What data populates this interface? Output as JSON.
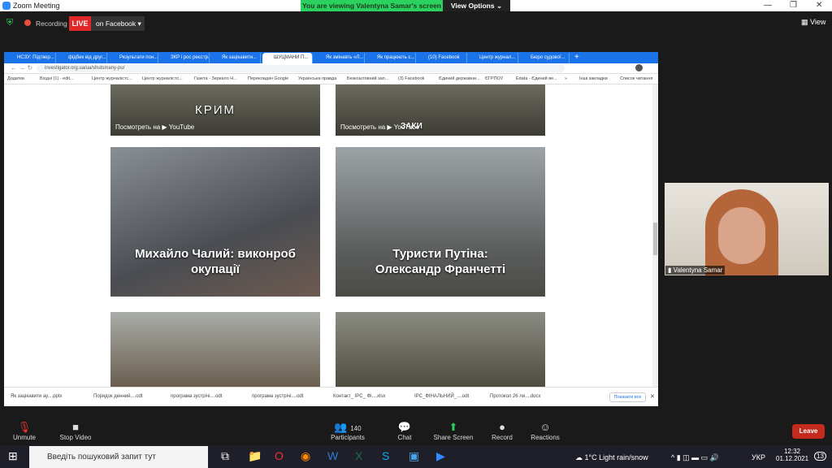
{
  "titlebar": {
    "title": "Zoom Meeting",
    "banner": "You are viewing Valentyna Samar's screen",
    "view_options": "View Options ⌄"
  },
  "meeting": {
    "recording": "Recording",
    "live": "LIVE",
    "live_target": "on Facebook ▾",
    "view": "View"
  },
  "browser": {
    "tabs": [
      "НСЗУ: Підтвер...",
      "фідбек від друг...",
      "Результати пон...",
      "ЗКР і рос реєстр...",
      "Як зацікавити...",
      "ШУЦМАНИ П...",
      "Як змінавть «Л...",
      "Як працюють с...",
      "(10) Facebook",
      "Центр журнал...",
      "Бюро судової..."
    ],
    "url": "investigator.org.ua/ua/shutsmany-pu/",
    "bookmarks": [
      "Додатки",
      "Вхідні (1) - edit...",
      "Центр журналістс...",
      "Центр журналістс...",
      "Газета - Зеркало Н...",
      "Перекладач Google",
      "Українська правда",
      "Безкоштовний зап...",
      "(3) Facebook",
      "Єдиний державни...",
      "ЄГРПОУ",
      "Edata - Єдиний ве...",
      "»",
      "Інші закладки",
      "Список читання"
    ],
    "cards": [
      {
        "caption": "КРИМ",
        "youtube": "Посмотреть на ▶ YouTube"
      },
      {
        "caption": "ЗАКИ",
        "youtube": "Посмотреть на ▶ YouTube"
      },
      {
        "caption": "Михайло Чалий: виконроб окупації"
      },
      {
        "caption": "Туристи Путіна: Олександр Франчетті"
      }
    ],
    "downloads": [
      "Як зацікавити ау....pptx",
      "Порядок денний....odt",
      "програма зустрічі....odt",
      "програма зустрічі....odt",
      "Контакт_ IPC_ Фі....xlsx",
      "IPC_ФІНАЛЬНИЙ_....odt",
      "Протокол 26 ли....docx"
    ],
    "show_all": "Показати все"
  },
  "video": {
    "name": "Valentyna Samar"
  },
  "toolbar": {
    "unmute": "Unmute",
    "stop_video": "Stop Video",
    "participants": "Participants",
    "participant_count": "140",
    "chat": "Chat",
    "share": "Share Screen",
    "record": "Record",
    "reactions": "Reactions",
    "leave": "Leave"
  },
  "taskbar": {
    "search_placeholder": "Введіть пошуковий запит тут",
    "weather": "1°C  Light rain/snow",
    "lang": "УКР",
    "time": "12:32",
    "date": "01.12.2021",
    "notifications": "13"
  },
  "colors": {
    "banner": "#2bd15f",
    "live": "#e02828",
    "chrome_tabs": "#1a73e8",
    "leave": "#c42b1c",
    "share": "#2bd15f"
  }
}
